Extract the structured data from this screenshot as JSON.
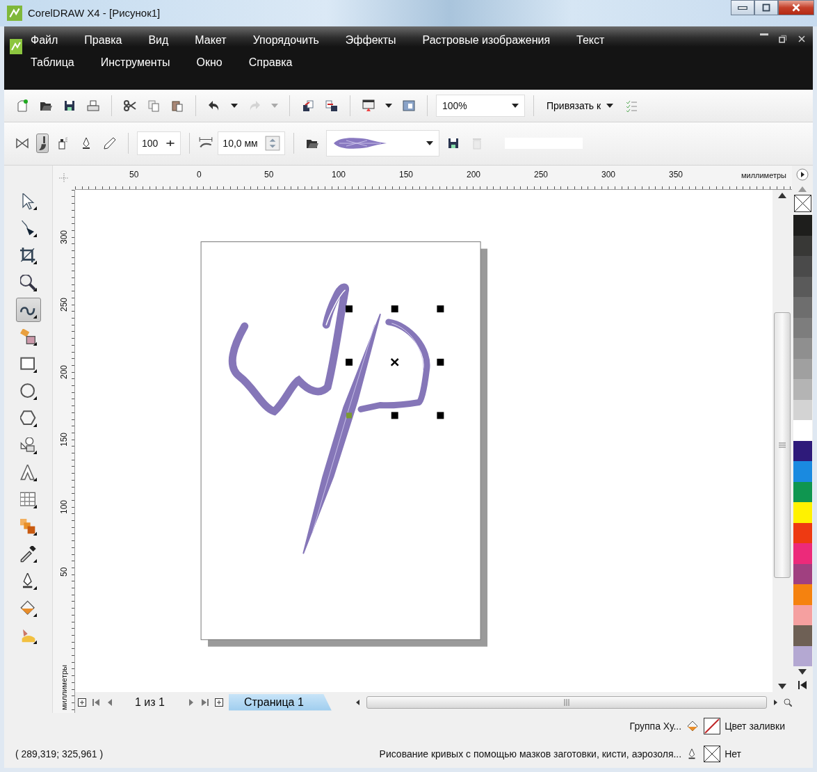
{
  "window": {
    "title": "CorelDRAW X4 - [Рисунок1]"
  },
  "menu": {
    "items": [
      {
        "label": "Файл"
      },
      {
        "label": "Правка"
      },
      {
        "label": "Вид"
      },
      {
        "label": "Макет"
      },
      {
        "label": "Упорядочить"
      },
      {
        "label": "Эффекты"
      },
      {
        "label": "Растровые изображения"
      },
      {
        "label": "Текст"
      },
      {
        "label": "Таблица"
      },
      {
        "label": "Инструменты"
      },
      {
        "label": "Окно"
      },
      {
        "label": "Справка"
      }
    ]
  },
  "standard_bar": {
    "zoom": "100%",
    "snap": "Привязать к",
    "redo_disabled": true
  },
  "property_bar": {
    "modes": [
      {
        "selected": false
      },
      {
        "selected": true
      },
      {
        "selected": false
      },
      {
        "selected": false
      },
      {
        "selected": false
      }
    ],
    "size": "100",
    "width": "10,0 мм",
    "delete_disabled": true
  },
  "toolbox": {
    "tools": [
      {
        "selected": false
      },
      {
        "selected": false
      },
      {
        "selected": false
      },
      {
        "selected": false
      },
      {
        "selected": true
      },
      {
        "selected": false
      },
      {
        "selected": false
      },
      {
        "selected": false
      },
      {
        "selected": false
      },
      {
        "selected": false
      },
      {
        "selected": false
      },
      {
        "selected": false
      },
      {
        "selected": false
      },
      {
        "selected": false
      },
      {
        "selected": false
      },
      {
        "selected": false
      },
      {
        "selected": false
      }
    ]
  },
  "rulers": {
    "horizontal": {
      "labels": [
        "50",
        "0",
        "50",
        "100",
        "150",
        "200",
        "250",
        "300",
        "350"
      ],
      "unit": "миллиметры"
    },
    "vertical": {
      "labels": [
        "300",
        "250",
        "200",
        "150",
        "100",
        "50"
      ],
      "unit": "миллиметры"
    }
  },
  "document": {
    "page_position": "1 из 1",
    "pages": [
      {
        "label": "Страница 1",
        "selected": true
      }
    ]
  },
  "palette": {
    "colors": [
      {
        "color": "#1e1e1c"
      },
      {
        "color": "#383836"
      },
      {
        "color": "#4a4a4a"
      },
      {
        "color": "#5a5a5a"
      },
      {
        "color": "#6e6e6e"
      },
      {
        "color": "#7d7d7d"
      },
      {
        "color": "#8f8f8f"
      },
      {
        "color": "#a0a0a0"
      },
      {
        "color": "#b4b4b4"
      },
      {
        "color": "#d3d3d3"
      },
      {
        "color": "#ffffff"
      },
      {
        "color": "#2e1a7a"
      },
      {
        "color": "#1a8ae0"
      },
      {
        "color": "#0f9650"
      },
      {
        "color": "#fff200"
      },
      {
        "color": "#ee3a12"
      },
      {
        "color": "#ec2a7a"
      },
      {
        "color": "#a04080"
      },
      {
        "color": "#f5820f"
      },
      {
        "color": "#f5a0a0"
      },
      {
        "color": "#6e6055"
      },
      {
        "color": "#b4a8d2"
      }
    ]
  },
  "status_bar": {
    "object": "Группа Ху...",
    "fill_label": "Цвет заливки",
    "coordinates": "( 289,319; 325,961 )",
    "hint": "Рисование кривых с помощью мазков заготовки, кисти, аэрозоля...",
    "outline_label": "Нет"
  }
}
